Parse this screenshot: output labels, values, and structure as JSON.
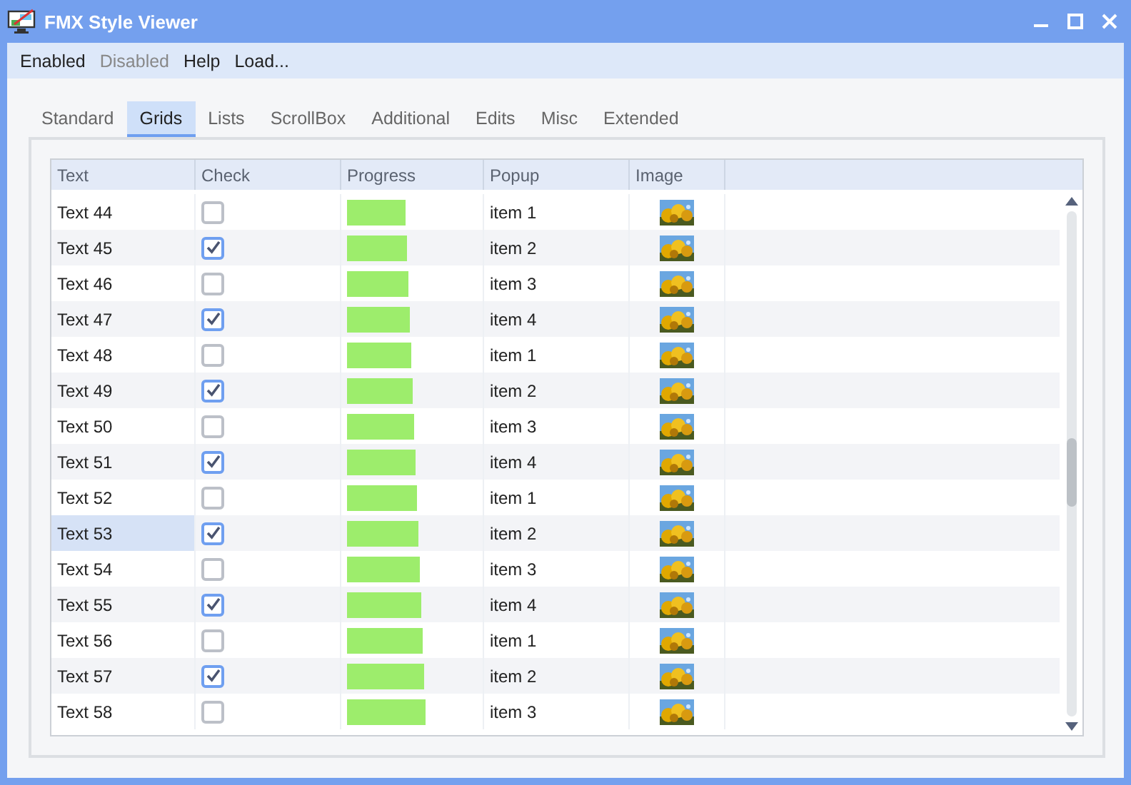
{
  "window": {
    "title": "FMX Style Viewer"
  },
  "menu": [
    {
      "label": "Enabled",
      "disabled": false
    },
    {
      "label": "Disabled",
      "disabled": true
    },
    {
      "label": "Help",
      "disabled": false
    },
    {
      "label": "Load...",
      "disabled": false
    }
  ],
  "tabs": [
    {
      "label": "Standard",
      "selected": false
    },
    {
      "label": "Grids",
      "selected": true
    },
    {
      "label": "Lists",
      "selected": false
    },
    {
      "label": "ScrollBox",
      "selected": false
    },
    {
      "label": "Additional",
      "selected": false
    },
    {
      "label": "Edits",
      "selected": false
    },
    {
      "label": "Misc",
      "selected": false
    },
    {
      "label": "Extended",
      "selected": false
    }
  ],
  "grid": {
    "columns": [
      "Text",
      "Check",
      "Progress",
      "Popup",
      "Image"
    ],
    "rows": [
      {
        "text": "Text 44",
        "checked": false,
        "level": 0.44,
        "popup": "item 1",
        "selected": false
      },
      {
        "text": "Text 45",
        "checked": true,
        "level": 0.45,
        "popup": "item 2",
        "selected": false
      },
      {
        "text": "Text 46",
        "checked": false,
        "level": 0.46,
        "popup": "item 3",
        "selected": false
      },
      {
        "text": "Text 47",
        "checked": true,
        "level": 0.47,
        "popup": "item 4",
        "selected": false
      },
      {
        "text": "Text 48",
        "checked": false,
        "level": 0.48,
        "popup": "item 1",
        "selected": false
      },
      {
        "text": "Text 49",
        "checked": true,
        "level": 0.49,
        "popup": "item 2",
        "selected": false
      },
      {
        "text": "Text 50",
        "checked": false,
        "level": 0.5,
        "popup": "item 3",
        "selected": false
      },
      {
        "text": "Text 51",
        "checked": true,
        "level": 0.51,
        "popup": "item 4",
        "selected": false
      },
      {
        "text": "Text 52",
        "checked": false,
        "level": 0.52,
        "popup": "item 1",
        "selected": false
      },
      {
        "text": "Text 53",
        "checked": true,
        "level": 0.53,
        "popup": "item 2",
        "selected": true
      },
      {
        "text": "Text 54",
        "checked": false,
        "level": 0.54,
        "popup": "item 3",
        "selected": false
      },
      {
        "text": "Text 55",
        "checked": true,
        "level": 0.55,
        "popup": "item 4",
        "selected": false
      },
      {
        "text": "Text 56",
        "checked": false,
        "level": 0.56,
        "popup": "item 1",
        "selected": false
      },
      {
        "text": "Text 57",
        "checked": true,
        "level": 0.57,
        "popup": "item 2",
        "selected": false
      },
      {
        "text": "Text 58",
        "checked": false,
        "level": 0.58,
        "popup": "item 3",
        "selected": false
      }
    ]
  }
}
